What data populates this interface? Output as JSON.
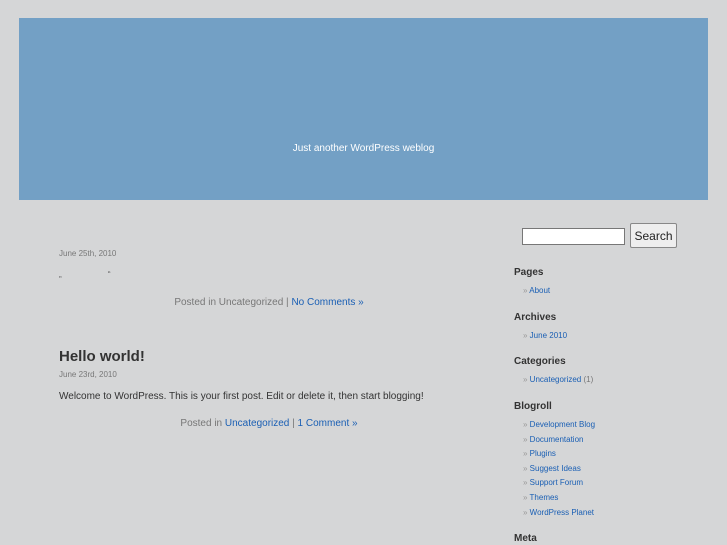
{
  "header": {
    "tagline": "Just another WordPress weblog"
  },
  "posts": [
    {
      "date": "June 25th, 2010",
      "quotes": "„ “",
      "meta_prefix": "Posted in Uncategorized |",
      "comments_link": "No Comments »"
    },
    {
      "title": "Hello world!",
      "date": "June 23rd, 2010",
      "body": "Welcome to WordPress. This is your first post. Edit or delete it, then start blogging!",
      "meta_prefix": "Posted in",
      "category_link": "Uncategorized",
      "separator": "|",
      "comments_link": "1 Comment »"
    }
  ],
  "sidebar": {
    "search": {
      "value": "",
      "button_label": "Search"
    },
    "pages": {
      "heading": "Pages",
      "items": [
        "About"
      ]
    },
    "archives": {
      "heading": "Archives",
      "items": [
        "June 2010"
      ]
    },
    "categories": {
      "heading": "Categories",
      "item": "Uncategorized",
      "count": "(1)"
    },
    "blogroll": {
      "heading": "Blogroll",
      "items": [
        "Development Blog",
        "Documentation",
        "Plugins",
        "Suggest Ideas",
        "Support Forum",
        "Themes",
        "WordPress Planet"
      ]
    },
    "meta": {
      "heading": "Meta"
    }
  }
}
